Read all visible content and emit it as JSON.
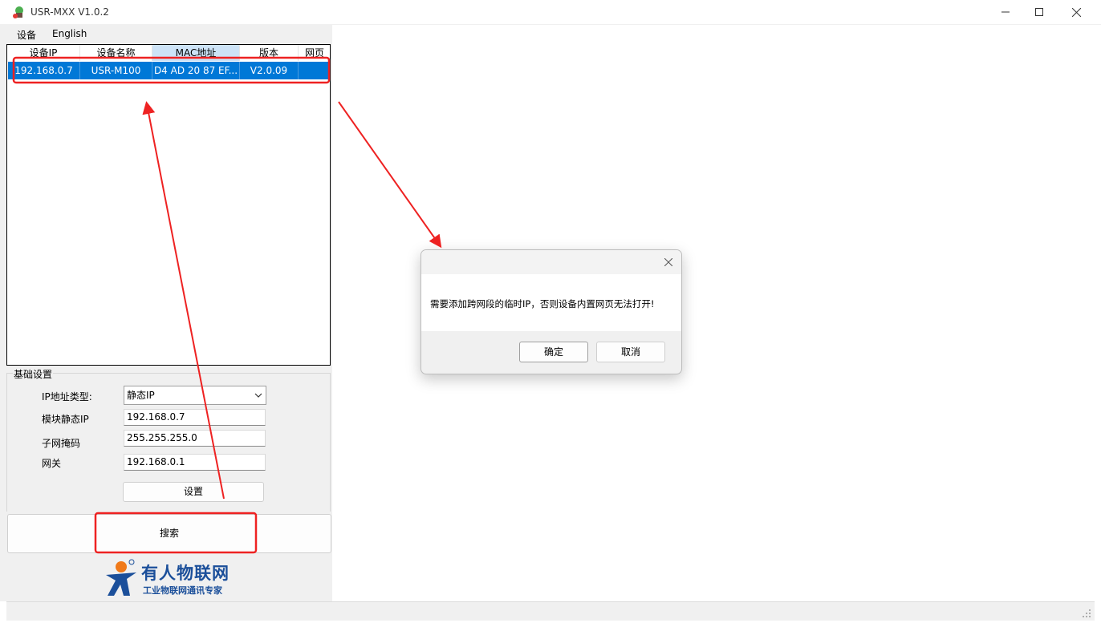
{
  "window": {
    "title": "USR-MXX  V1.0.2",
    "minimize_icon": "minimize-icon",
    "maximize_icon": "maximize-icon",
    "close_icon": "close-icon"
  },
  "menu": {
    "items": [
      {
        "label": "设备"
      },
      {
        "label": "English"
      }
    ]
  },
  "device_list": {
    "columns": [
      "设备IP",
      "设备名称",
      "MAC地址",
      "版本",
      "网页"
    ],
    "rows": [
      {
        "ip": "192.168.0.7",
        "name": "USR-M100",
        "mac": "D4 AD 20 87 EF...",
        "version": "V2.0.09",
        "web": ""
      }
    ]
  },
  "basic_settings": {
    "legend": "基础设置",
    "ip_type_label": "IP地址类型:",
    "ip_type_value": "静态IP",
    "static_ip_label": "模块静态IP",
    "static_ip_value": "192.168.0.7",
    "subnet_label": "子网掩码",
    "subnet_value": "255.255.255.0",
    "gateway_label": "网关",
    "gateway_value": "192.168.0.1",
    "set_button": "设置"
  },
  "search_button": "搜索",
  "logo": {
    "main": "有人物联网",
    "sub": "工业物联网通讯专家"
  },
  "dialog": {
    "message": "需要添加跨网段的临时IP，否则设备内置网页无法打开!",
    "ok_label": "确定",
    "cancel_label": "取消"
  },
  "colors": {
    "selection": "#0078d7",
    "annotation": "#ee2222",
    "logo_blue": "#1b4f9a",
    "logo_orange": "#f07a1a"
  }
}
